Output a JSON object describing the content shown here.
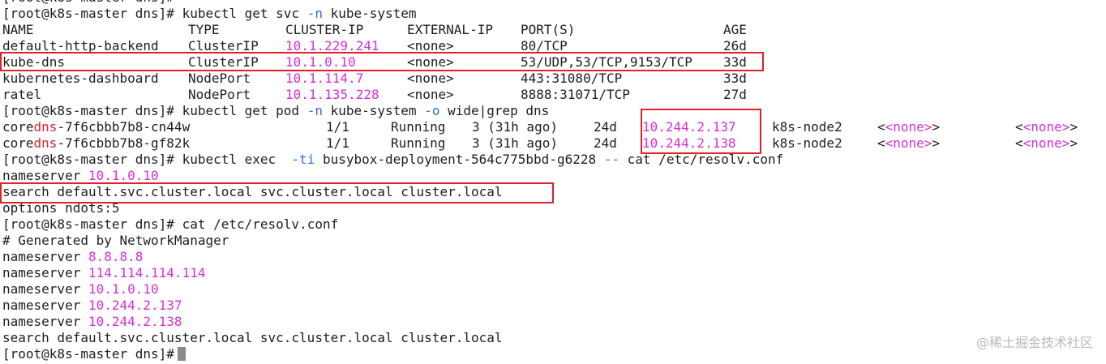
{
  "terminal": {
    "prompt": "[root@k8s-master dns]# ",
    "partial_prompt": "[root@k8s-master dns]#",
    "cmd_get_svc": {
      "pre": "kubectl get svc ",
      "flag": "-n",
      "post": " kube-system"
    },
    "svc_table": {
      "headers": [
        "NAME",
        "TYPE",
        "CLUSTER-IP",
        "EXTERNAL-IP",
        "PORT(S)",
        "AGE"
      ],
      "rows": [
        [
          "default-http-backend",
          "ClusterIP",
          "10.1.229.241",
          "<none>",
          "80/TCP",
          "26d"
        ],
        [
          "kube-dns",
          "ClusterIP",
          "10.1.0.10",
          "<none>",
          "53/UDP,53/TCP,9153/TCP",
          "33d"
        ],
        [
          "kubernetes-dashboard",
          "NodePort",
          "10.1.114.7",
          "<none>",
          "443:31080/TCP",
          "33d"
        ],
        [
          "ratel",
          "NodePort",
          "10.1.135.228",
          "<none>",
          "8888:31071/TCP",
          "27d"
        ]
      ]
    },
    "cmd_get_pod": {
      "pre": "kubectl get pod ",
      "flag1": "-n",
      "mid": " kube-system ",
      "flag2": "-o",
      "post": " wide|grep dns"
    },
    "pod_rows": [
      {
        "name_pre": "core",
        "name_match": "dns",
        "name_post": "-7f6cbbb7b8-cn44w",
        "ready": "1/1",
        "status": "Running",
        "restarts": "3 (31h ago)",
        "age": "24d",
        "ip": "10.244.2.137",
        "node": "k8s-node2",
        "nominated": "<none>",
        "gates": "<none>"
      },
      {
        "name_pre": "core",
        "name_match": "dns",
        "name_post": "-7f6cbbb7b8-gf82k",
        "ready": "1/1",
        "status": "Running",
        "restarts": "3 (31h ago)",
        "age": "24d",
        "ip": "10.244.2.138",
        "node": "k8s-node2",
        "nominated": "<none>",
        "gates": "<none>"
      }
    ],
    "cmd_exec": {
      "pre": "kubectl exec  ",
      "flag": "-ti",
      "mid": " busybox-deployment-564c775bbd-g6228 ",
      "dashes": "--",
      "post": " cat /etc/resolv.conf"
    },
    "pod_resolv": {
      "nameserver_label": "nameserver ",
      "nameserver_ip": "10.1.0.10",
      "search": "search default.svc.cluster.local svc.cluster.local cluster.local",
      "options": "options ndots:5"
    },
    "cmd_cat": "cat /etc/resolv.conf",
    "host_resolv": {
      "comment": "# Generated by NetworkManager",
      "nameserver_label": "nameserver ",
      "nameservers": [
        "8.8.8.8",
        "114.114.114.114",
        "10.1.0.10",
        "10.244.2.137",
        "10.244.2.138"
      ],
      "search": "search default.svc.cluster.local svc.cluster.local cluster.local"
    }
  },
  "watermark": "@稀土掘金技术社区",
  "colors": {
    "highlight_box": "#e0202a",
    "ip_text": "#d62fd6",
    "flag_text": "#2f6fd6",
    "text": "#1e1e1e"
  }
}
